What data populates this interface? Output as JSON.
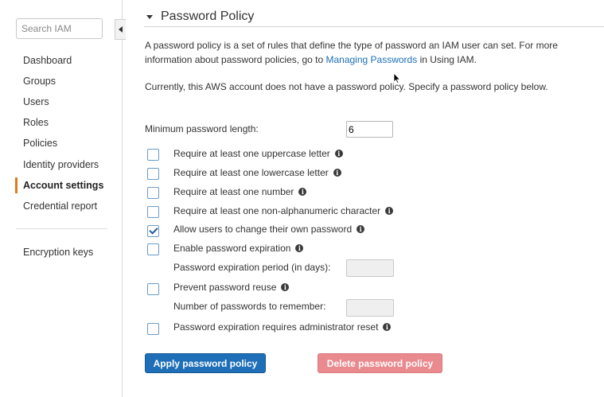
{
  "sidebar": {
    "search_placeholder": "Search IAM",
    "items": [
      {
        "label": "Dashboard"
      },
      {
        "label": "Groups"
      },
      {
        "label": "Users"
      },
      {
        "label": "Roles"
      },
      {
        "label": "Policies"
      },
      {
        "label": "Identity providers"
      },
      {
        "label": "Account settings"
      },
      {
        "label": "Credential report"
      },
      {
        "label": "Encryption keys"
      }
    ],
    "active_index": 6,
    "accent_color": "#e07b1a"
  },
  "section": {
    "title": "Password Policy",
    "intro_text": "A password policy is a set of rules that define the type of password an IAM user can set. For more information about password policies, go to",
    "intro_link": "Managing Passwords",
    "intro_suffix": "in Using IAM.",
    "status_text": "Currently, this AWS account does not have a password policy. Specify a password policy below."
  },
  "form": {
    "min_length_label": "Minimum password length:",
    "min_length_value": "6",
    "options": [
      {
        "label": "Require at least one uppercase letter",
        "checked": false
      },
      {
        "label": "Require at least one lowercase letter",
        "checked": false
      },
      {
        "label": "Require at least one number",
        "checked": false
      },
      {
        "label": "Require at least one non-alphanumeric character",
        "checked": false
      },
      {
        "label": "Allow users to change their own password",
        "checked": true
      },
      {
        "label": "Enable password expiration",
        "checked": false
      },
      {
        "label": "Prevent password reuse",
        "checked": false
      },
      {
        "label": "Password expiration requires administrator reset",
        "checked": false
      }
    ],
    "expiration_period_label": "Password expiration period (in days):",
    "reuse_count_label": "Number of passwords to remember:"
  },
  "buttons": {
    "apply": "Apply password policy",
    "delete": "Delete password policy",
    "apply_color": "#1f6fb8",
    "delete_color": "#e98a8f"
  },
  "icons": {
    "info": "info-icon",
    "collapse": "chevron-left-icon",
    "caret": "caret-down-icon"
  }
}
